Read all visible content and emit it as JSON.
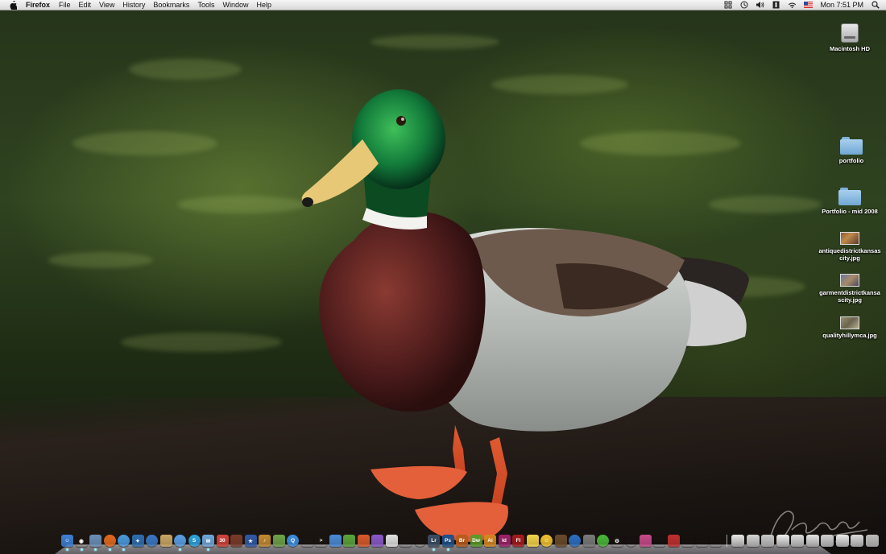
{
  "menubar": {
    "app_name": "Firefox",
    "items": [
      "File",
      "Edit",
      "View",
      "History",
      "Bookmarks",
      "Tools",
      "Window",
      "Help"
    ],
    "clock": "Mon 7:51 PM",
    "status_icons": [
      "spaces-icon",
      "time-machine-icon",
      "volume-icon",
      "script-icon",
      "wifi-icon",
      "us-flag-icon",
      "spotlight-icon"
    ]
  },
  "desktop_icons": [
    {
      "label": "Macintosh HD",
      "kind": "drive"
    },
    {
      "label": "portfolio",
      "kind": "folder"
    },
    {
      "label": "Portfolio - mid 2008",
      "kind": "folder"
    },
    {
      "label": "antiquedistrictkansascity.jpg",
      "kind": "image"
    },
    {
      "label": "garmentdistrictkansascity.jpg",
      "kind": "image"
    },
    {
      "label": "qualityhillymca.jpg",
      "kind": "image"
    }
  ],
  "dock": {
    "apps": [
      {
        "name": "finder-icon",
        "color": "#3d7fd6",
        "glyph": "☺",
        "running": true
      },
      {
        "name": "dashboard-icon",
        "color": "#444",
        "glyph": "◉",
        "running": true
      },
      {
        "name": "preview-icon",
        "color": "#6b8fb8",
        "glyph": "",
        "running": true
      },
      {
        "name": "firefox-icon",
        "color": "#e36a1e",
        "glyph": "",
        "running": true,
        "round": true
      },
      {
        "name": "safari-icon",
        "color": "#4a9be0",
        "glyph": "",
        "running": true,
        "round": true
      },
      {
        "name": "network-icon",
        "color": "#2c6fb0",
        "glyph": "✦",
        "running": false
      },
      {
        "name": "globe-icon",
        "color": "#3a77c4",
        "glyph": "",
        "running": false,
        "round": true
      },
      {
        "name": "notes-icon",
        "color": "#c9a664",
        "glyph": "",
        "running": false
      },
      {
        "name": "ichat-icon",
        "color": "#5aa0e8",
        "glyph": "",
        "running": true,
        "round": true
      },
      {
        "name": "skype-icon",
        "color": "#2aa3e0",
        "glyph": "S",
        "running": false,
        "round": true
      },
      {
        "name": "mail-icon",
        "color": "#6fa6d9",
        "glyph": "✉",
        "running": true
      },
      {
        "name": "calendar-icon",
        "color": "#d0433a",
        "glyph": "30",
        "running": false
      },
      {
        "name": "photobooth-icon",
        "color": "#7a3b2a",
        "glyph": "",
        "running": false
      },
      {
        "name": "imovie-icon",
        "color": "#2f59a8",
        "glyph": "★",
        "running": false
      },
      {
        "name": "garageband-icon",
        "color": "#c28a2f",
        "glyph": "♪",
        "running": false
      },
      {
        "name": "iphoto-icon",
        "color": "#6da34a",
        "glyph": "",
        "running": false
      },
      {
        "name": "quicktime-icon",
        "color": "#3c8ee0",
        "glyph": "Q",
        "running": false,
        "round": true
      },
      {
        "name": "camera-icon",
        "color": "#777",
        "glyph": "",
        "running": false
      },
      {
        "name": "terminal-icon",
        "color": "#222",
        "glyph": ">",
        "running": false
      },
      {
        "name": "coda-icon",
        "color": "#4a8bd6",
        "glyph": "",
        "running": false
      },
      {
        "name": "leaf-icon",
        "color": "#5aa43c",
        "glyph": "",
        "running": false
      },
      {
        "name": "growl-icon",
        "color": "#d85a2a",
        "glyph": "",
        "running": false
      },
      {
        "name": "plugin-icon",
        "color": "#8a5ac8",
        "glyph": "",
        "running": false
      },
      {
        "name": "textedit-icon",
        "color": "#e0e0e0",
        "glyph": "",
        "running": false
      },
      {
        "name": "aperture-icon",
        "color": "#555",
        "glyph": "",
        "running": false
      },
      {
        "name": "lens-icon",
        "color": "#333",
        "glyph": "",
        "running": false,
        "round": true
      },
      {
        "name": "lightroom-icon",
        "color": "#3b4d63",
        "glyph": "Lr",
        "running": true
      },
      {
        "name": "photoshop-icon",
        "color": "#1e4f8a",
        "glyph": "Ps",
        "running": true
      },
      {
        "name": "bridge-icon",
        "color": "#b85b1c",
        "glyph": "Br",
        "running": false
      },
      {
        "name": "dreamweaver-icon",
        "color": "#5a9a2a",
        "glyph": "Dw",
        "running": false
      },
      {
        "name": "illustrator-icon",
        "color": "#d7861c",
        "glyph": "Ai",
        "running": false
      },
      {
        "name": "indesign-icon",
        "color": "#a0226a",
        "glyph": "Id",
        "running": false
      },
      {
        "name": "flash-icon",
        "color": "#a41c1c",
        "glyph": "Fl",
        "running": false
      },
      {
        "name": "stickies-icon",
        "color": "#f2d44a",
        "glyph": "",
        "running": false
      },
      {
        "name": "smiley-icon",
        "color": "#f2c12e",
        "glyph": "☺",
        "running": false,
        "round": true
      },
      {
        "name": "wand-icon",
        "color": "#6a4a2a",
        "glyph": "",
        "running": false
      },
      {
        "name": "marble-icon",
        "color": "#2b6fc4",
        "glyph": "",
        "running": false,
        "round": true
      },
      {
        "name": "utorrent-icon",
        "color": "#7a7a7a",
        "glyph": "",
        "running": false
      },
      {
        "name": "frog-icon",
        "color": "#4ab83a",
        "glyph": "",
        "running": false,
        "round": true
      },
      {
        "name": "gear-icon",
        "color": "#888",
        "glyph": "⚙",
        "running": false
      },
      {
        "name": "network-globe-icon",
        "color": "#667",
        "glyph": "",
        "running": false,
        "round": true
      },
      {
        "name": "colorsync-icon",
        "color": "#c84a8a",
        "glyph": "",
        "running": false
      },
      {
        "name": "paint-icon",
        "color": "#bbb",
        "glyph": "",
        "running": false
      },
      {
        "name": "automator-icon",
        "color": "#c03030",
        "glyph": "",
        "running": false
      },
      {
        "name": "utilities-icon",
        "color": "#999",
        "glyph": "",
        "running": false
      },
      {
        "name": "photos-icon",
        "color": "#ccc",
        "glyph": "",
        "running": false
      },
      {
        "name": "scanner-icon",
        "color": "#aaa",
        "glyph": "",
        "running": false
      }
    ],
    "stacks": [
      {
        "name": "cloud-stack-icon",
        "color": "#e8e8e8"
      },
      {
        "name": "window-stack-1-icon",
        "color": "#d4d4d4"
      },
      {
        "name": "window-stack-2-icon",
        "color": "#c8c8c8"
      },
      {
        "name": "document-stack-1-icon",
        "color": "#f0f0f0"
      },
      {
        "name": "document-stack-2-icon",
        "color": "#dcdcdc"
      },
      {
        "name": "document-stack-3-icon",
        "color": "#e4e4e4"
      },
      {
        "name": "document-stack-4-icon",
        "color": "#d0d0d0"
      },
      {
        "name": "document-stack-5-icon",
        "color": "#ececec"
      },
      {
        "name": "document-stack-6-icon",
        "color": "#dadada"
      },
      {
        "name": "trash-icon",
        "color": "#bcbcbc"
      }
    ]
  },
  "wallpaper": {
    "subject": "mallard duck",
    "signature": "Lisa Bowers 2008"
  }
}
